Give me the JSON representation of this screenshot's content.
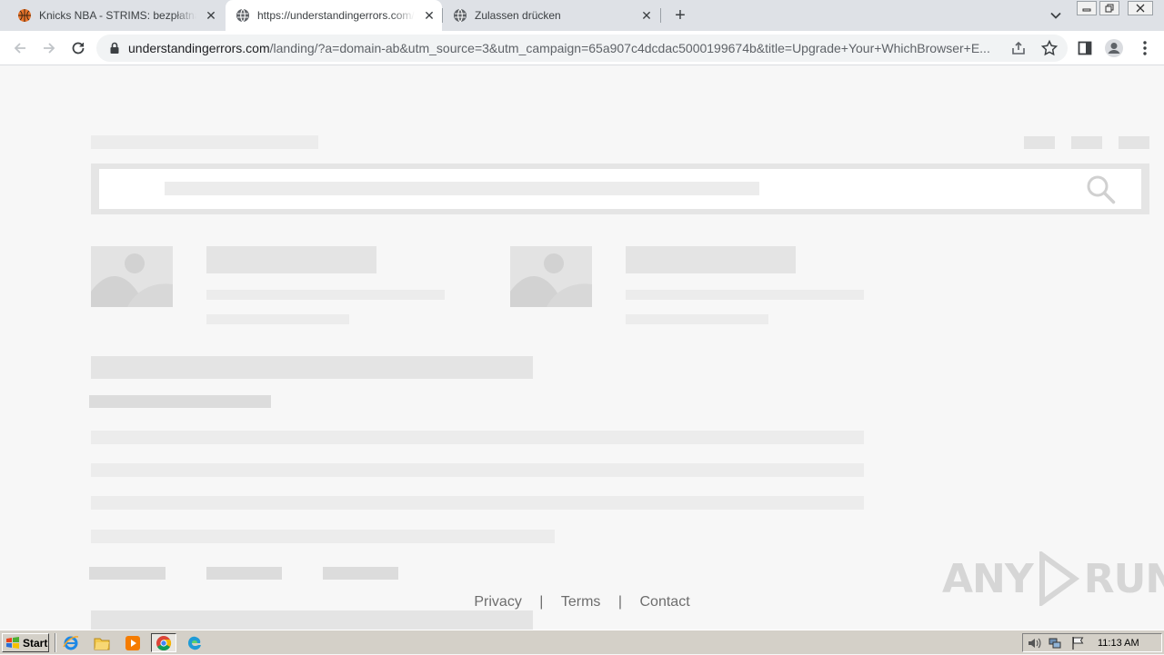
{
  "browser": {
    "tabs": [
      {
        "title": "Knicks NBA - STRIMS: bezpłatna transmisja",
        "favicon": "basketball-icon",
        "active": false
      },
      {
        "title": "https://understandingerrors.com/landing/",
        "favicon": "globe-icon",
        "active": true
      },
      {
        "title": "Zulassen drücken",
        "favicon": "globe-icon",
        "active": false
      }
    ],
    "close_glyph": "✕",
    "new_tab_glyph": "+",
    "window_controls": [
      "minimize",
      "restore",
      "close"
    ],
    "address": {
      "host": "understandingerrors.com",
      "path": "/landing/?a=domain-ab&utm_source=3&utm_campaign=65a907c4dcdac5000199674b&title=Upgrade+Your+WhichBrowser+E..."
    }
  },
  "page": {
    "footer": {
      "links": [
        "Privacy",
        "Terms",
        "Contact"
      ],
      "separator": "|"
    },
    "watermark": {
      "left": "ANY",
      "right": "RUN"
    }
  },
  "taskbar": {
    "start_label": "Start",
    "apps": [
      "internet-explorer-icon",
      "file-explorer-icon",
      "media-player-icon",
      "chrome-icon",
      "edge-icon"
    ],
    "clock": "11:13 AM"
  },
  "colors": {
    "tabstrip": "#dee1e6",
    "skeleton": "#e4e4e4",
    "page_bg": "#f7f7f7",
    "taskbar": "#d4d0c8"
  }
}
